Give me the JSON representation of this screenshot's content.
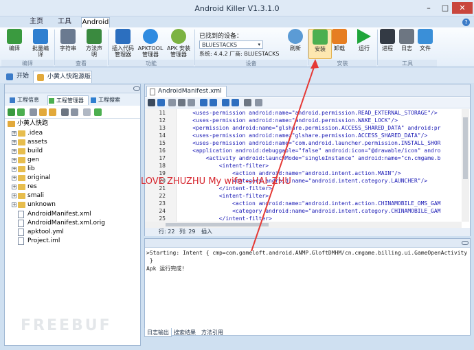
{
  "window": {
    "title": "Android Killer V1.3.1.0",
    "min": "–",
    "max": "□",
    "close": "✕"
  },
  "menu_tabs": [
    "主页",
    "工具",
    "Android"
  ],
  "help_label": "?",
  "ribbon": {
    "buttons": [
      {
        "label1": "编译",
        "label2": "",
        "icon": "build-icon",
        "color": "#3a9a3f"
      },
      {
        "label1": "批量编",
        "label2": "译",
        "icon": "batch-build-icon",
        "color": "#2f7fd0"
      },
      {
        "label1": "字符串",
        "label2": "",
        "icon": "string-icon",
        "color": "#6a7a90"
      },
      {
        "label1": "方法声",
        "label2": "明",
        "icon": "method-icon",
        "color": "#3a8a3f"
      },
      {
        "label1": "插入代码",
        "label2": "管理器",
        "icon": "code-insert-icon",
        "color": "#2c6fbf"
      },
      {
        "label1": "APKTOOL",
        "label2": "管理器",
        "icon": "apktool-icon",
        "color": "#2f8be0"
      },
      {
        "label1": "APK 安装",
        "label2": "管理器",
        "icon": "apk-install-manager-icon",
        "color": "#7cb342"
      },
      {
        "label1": "刷新",
        "label2": "",
        "icon": "refresh-icon",
        "color": "#5b9bd5"
      },
      {
        "label1": "安装",
        "label2": "",
        "icon": "install-icon",
        "color": "#4caf50"
      },
      {
        "label1": "卸载",
        "label2": "",
        "icon": "uninstall-icon",
        "color": "#e67e22"
      },
      {
        "label1": "运行",
        "label2": "",
        "icon": "run-icon",
        "color": "#1fa53a"
      },
      {
        "label1": "进程",
        "label2": "",
        "icon": "process-icon",
        "color": "#333a44"
      },
      {
        "label1": "日志",
        "label2": "",
        "icon": "log-icon",
        "color": "#6d7682"
      },
      {
        "label1": "文件",
        "label2": "",
        "icon": "file-icon",
        "color": "#3a8fd8"
      }
    ],
    "groups": [
      "编译",
      "查看",
      "功能",
      "设备",
      "安装",
      "工具"
    ],
    "device_found_label": "已找到的设备：",
    "device_selected": "BLUESTACKS",
    "system_info": "系统: 4.4.2  厂商: BLUESTACKS"
  },
  "doc_tabs": [
    "开始",
    "小黄人快跑源版"
  ],
  "left_panel": {
    "tabs": [
      "工程信息",
      "工程管理器",
      "工程搜索"
    ],
    "tree": [
      {
        "label": "小黄人快跑",
        "type": "root"
      },
      {
        "label": ".idea",
        "type": "folder"
      },
      {
        "label": "assets",
        "type": "folder"
      },
      {
        "label": "build",
        "type": "folder"
      },
      {
        "label": "gen",
        "type": "folder"
      },
      {
        "label": "lib",
        "type": "folder"
      },
      {
        "label": "original",
        "type": "folder"
      },
      {
        "label": "res",
        "type": "folder"
      },
      {
        "label": "smali",
        "type": "folder"
      },
      {
        "label": "unknown",
        "type": "folder"
      },
      {
        "label": "AndroidManifest.xml",
        "type": "file"
      },
      {
        "label": "AndroidManifest.xml.orig",
        "type": "file"
      },
      {
        "label": "apktool.yml",
        "type": "file"
      },
      {
        "label": "Project.iml",
        "type": "file"
      }
    ]
  },
  "editor": {
    "tab": "AndroidManifest.xml",
    "lines": [
      {
        "n": "11",
        "t": "    <uses-permission android:name=\"android.permission.READ_EXTERNAL_STORAGE\"/>"
      },
      {
        "n": "12",
        "t": "    <uses-permission android:name=\"android.permission.WAKE_LOCK\"/>"
      },
      {
        "n": "13",
        "t": "    <permission android:name=\"glshare.permission.ACCESS_SHARED_DATA\" android:pr"
      },
      {
        "n": "14",
        "t": "    <uses-permission android:name=\"glshare.permission.ACCESS_SHARED_DATA\"/>"
      },
      {
        "n": "15",
        "t": "    <uses-permission android:name=\"com.android.launcher.permission.INSTALL_SHOR"
      },
      {
        "n": "16",
        "t": "    <application android:debuggable=\"false\" android:icon=\"@drawable/icon\" andro"
      },
      {
        "n": "17",
        "t": "        <activity android:launchMode=\"singleInstance\" android:name=\"cn.cmgame.b"
      },
      {
        "n": "18",
        "t": "            <intent-filter>"
      },
      {
        "n": "19",
        "t": "                <action android:name=\"android.intent.action.MAIN\"/>"
      },
      {
        "n": "20",
        "t": "                <category android:name=\"android.intent.category.LAUNCHER\"/>"
      },
      {
        "n": "21",
        "t": "            </intent-filter>"
      },
      {
        "n": "22",
        "t": "            <intent-filter>"
      },
      {
        "n": "23",
        "t": "                <action android:name=\"android.intent.action.CHINAMOBILE_OMS_GAM"
      },
      {
        "n": "24",
        "t": "                <category android:name=\"android.intent.category.CHINAMOBILE_GAM"
      },
      {
        "n": "25",
        "t": "            </intent-filter>"
      }
    ],
    "status": {
      "row": "行: 22",
      "col": "列: 29",
      "mode": "插入"
    }
  },
  "log": {
    "lines": [
      ">Starting: Intent { cmp=com.gameloft.android.ANMP.GloftDMHM/cn.cmgame.billing.ui.GameOpenActivity",
      " }",
      "Apk 运行完成!"
    ],
    "tabs": [
      "日志输出",
      "搜索结果",
      "方法引用"
    ]
  },
  "overlay_text": "LOVE ZHUZHU    My wife --HAI_ZHU",
  "watermark": "FREEBUF",
  "colors": {
    "accent": "#3b7bc8",
    "arrow": "#e53935"
  }
}
